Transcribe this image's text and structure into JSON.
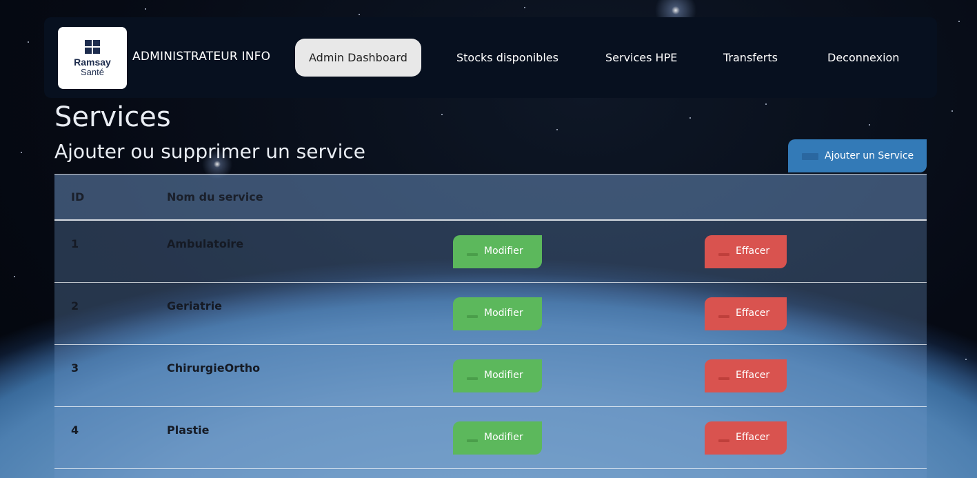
{
  "nav": {
    "logo": {
      "name": "Ramsay",
      "sub": "Santé"
    },
    "brand": "ADMINISTRATEUR INFO",
    "items": [
      {
        "label": "Admin Dashboard",
        "active": true
      },
      {
        "label": "Stocks disponibles",
        "active": false
      },
      {
        "label": "Services HPE",
        "active": false
      },
      {
        "label": "Transferts",
        "active": false
      },
      {
        "label": "Deconnexion",
        "active": false
      }
    ]
  },
  "page": {
    "title": "Services",
    "subtitle": "Ajouter ou supprimer un service",
    "add_button": "Ajouter un Service"
  },
  "table": {
    "headers": {
      "id": "ID",
      "name": "Nom du service"
    },
    "rows": [
      {
        "id": "1",
        "name": "Ambulatoire",
        "edit": "Modifier",
        "delete": "Effacer"
      },
      {
        "id": "2",
        "name": "Geriatrie",
        "edit": "Modifier",
        "delete": "Effacer"
      },
      {
        "id": "3",
        "name": "ChirurgieOrtho",
        "edit": "Modifier",
        "delete": "Effacer"
      },
      {
        "id": "4",
        "name": "Plastie",
        "edit": "Modifier",
        "delete": "Effacer"
      }
    ]
  },
  "colors": {
    "nav_bg": "#07101f",
    "primary": "#337ab7",
    "success": "#5cb85c",
    "danger": "#d9534f"
  },
  "icons": {
    "add_button_icon": "plus-icon",
    "edit_button_icon": "pencil-icon",
    "delete_button_icon": "trash-icon"
  }
}
